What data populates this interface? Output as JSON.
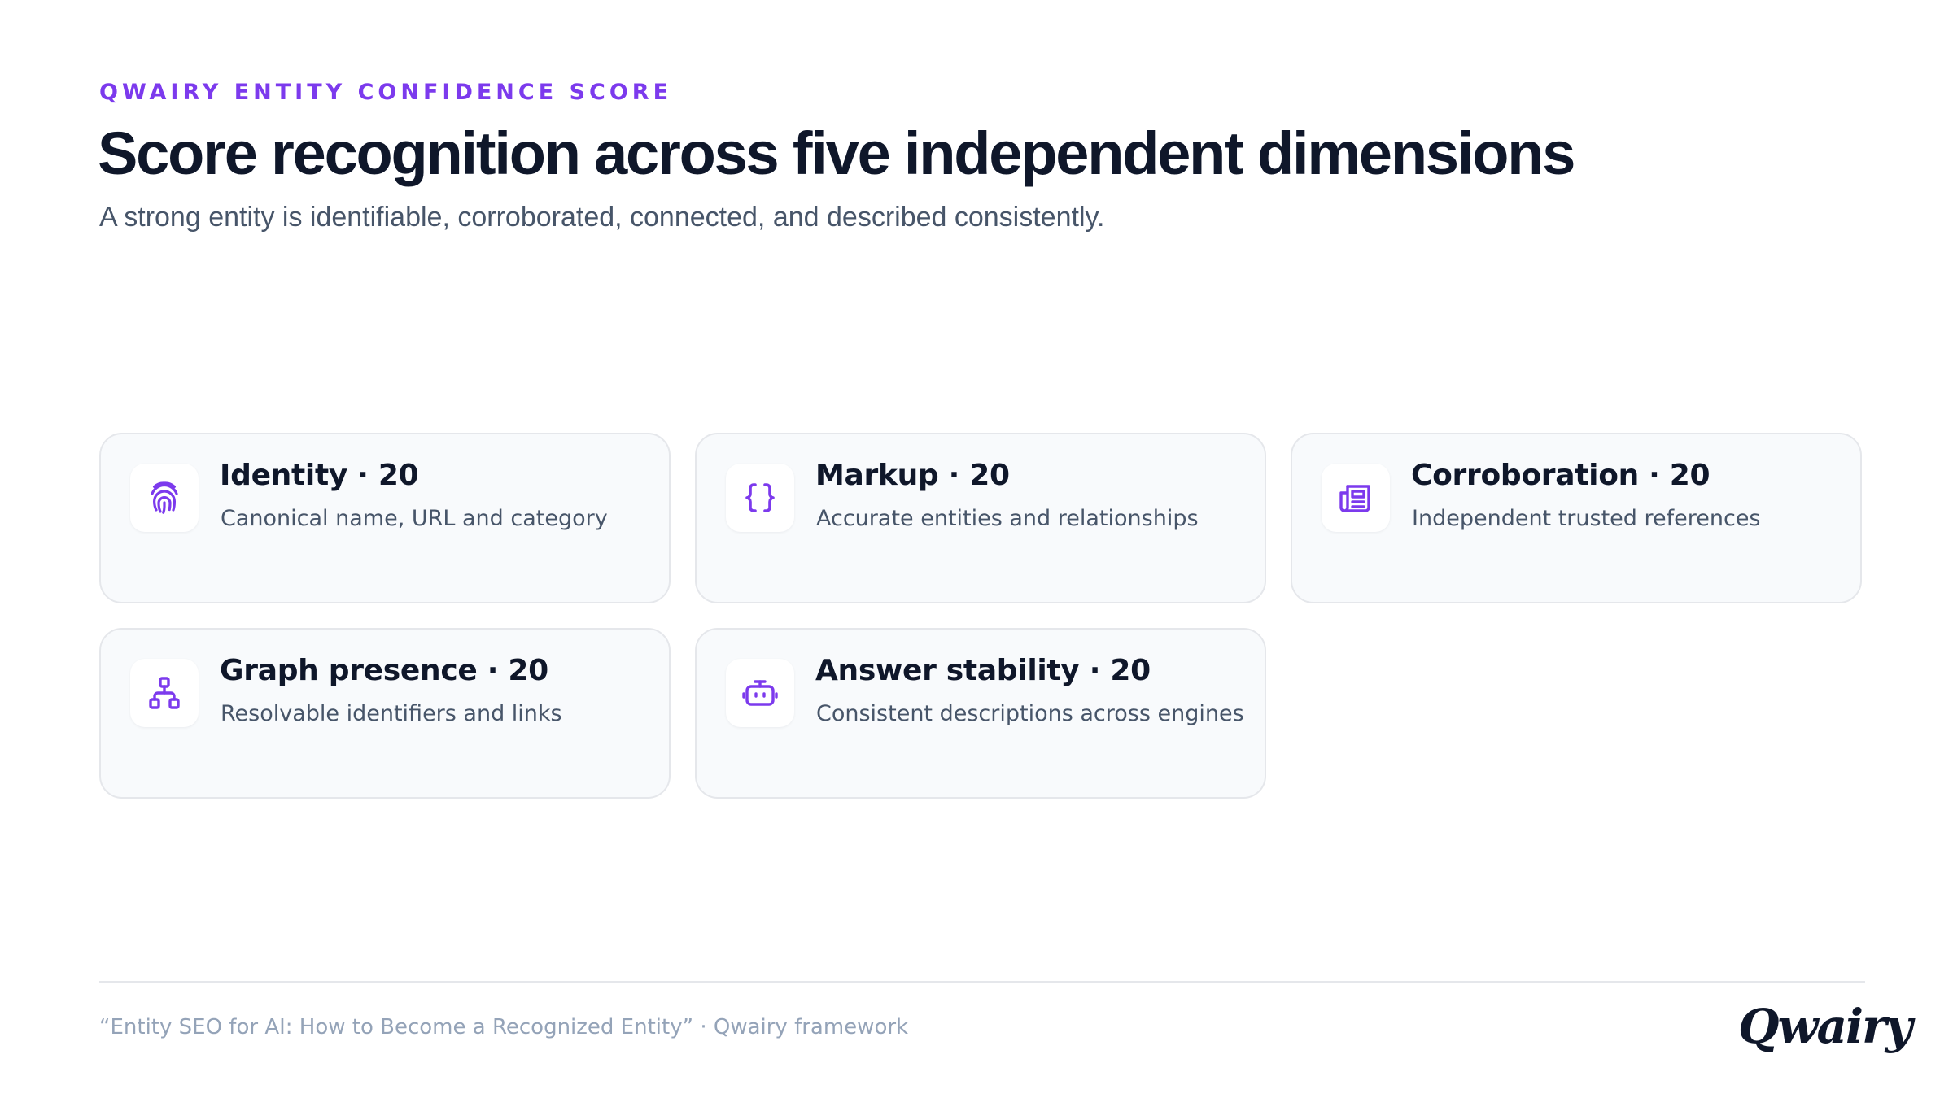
{
  "header": {
    "eyebrow": "QWAIRY ENTITY CONFIDENCE SCORE",
    "title": "Score recognition across five independent dimensions",
    "subtitle": "A strong entity is identifiable, corroborated, connected, and described consistently."
  },
  "colors": {
    "accent": "#7c3aed",
    "title": "#0f172a",
    "body": "#475569",
    "muted": "#94a3b8",
    "card_bg": "#f8fafc",
    "card_border": "#e5e7eb"
  },
  "dimensions": [
    {
      "title": "Identity · 20",
      "description": "Canonical name, URL and category",
      "icon": "fingerprint-icon"
    },
    {
      "title": "Markup · 20",
      "description": "Accurate entities and relationships",
      "icon": "code-braces-icon"
    },
    {
      "title": "Corroboration · 20",
      "description": "Independent trusted references",
      "icon": "newspaper-icon"
    },
    {
      "title": "Graph presence · 20",
      "description": "Resolvable identifiers and links",
      "icon": "hierarchy-icon"
    },
    {
      "title": "Answer stability · 20",
      "description": "Consistent descriptions across engines",
      "icon": "robot-icon"
    }
  ],
  "footer": {
    "source": "“Entity SEO for AI: How to Become a Recognized Entity” · Qwairy framework",
    "logo": "Qwairy"
  }
}
